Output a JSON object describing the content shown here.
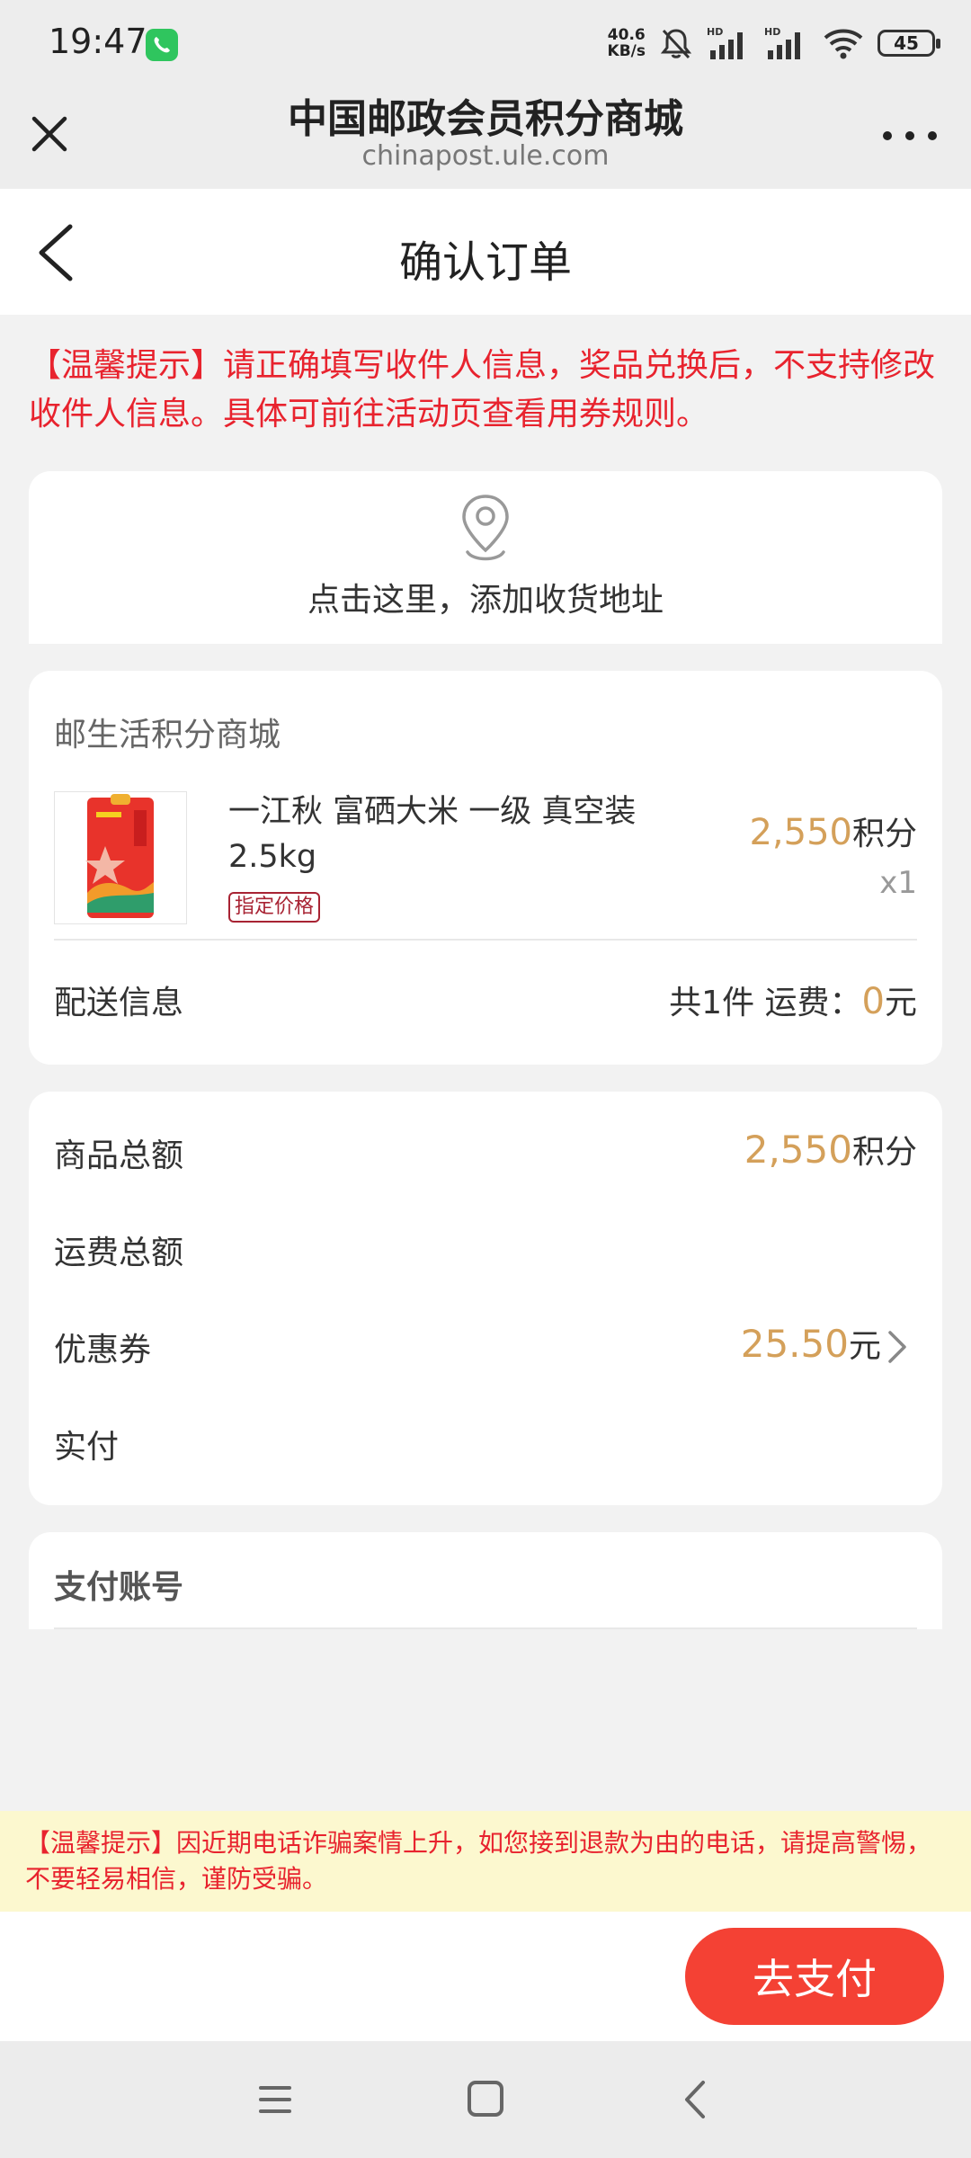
{
  "status_bar": {
    "time": "19:47",
    "net_speed_value": "40.6",
    "net_speed_unit": "KB/s",
    "battery": "45"
  },
  "browser": {
    "title": "中国邮政会员积分商城",
    "url": "chinapost.ule.com"
  },
  "page": {
    "title": "确认订单"
  },
  "notice": "【温馨提示】请正确填写收件人信息，奖品兑换后，不支持修改收件人信息。具体可前往活动页查看用券规则。",
  "address": {
    "prompt": "点击这里，添加收货地址"
  },
  "order": {
    "store_name": "邮生活积分商城",
    "product": {
      "name": "一江秋 富硒大米 一级 真空装 2.5kg",
      "tag": "指定价格",
      "price": "2,550",
      "price_unit": "积分",
      "quantity": "x1"
    },
    "delivery": {
      "label": "配送信息",
      "count_text": "共1件 运费：",
      "fee": "0",
      "fee_unit": "元"
    }
  },
  "summary": {
    "goods_total_label": "商品总额",
    "goods_total_value": "2,550",
    "goods_total_unit": "积分",
    "shipping_total_label": "运费总额",
    "coupon_label": "优惠券",
    "coupon_value": "25.50",
    "coupon_unit": "元",
    "actual_label": "实付"
  },
  "payment": {
    "account_label": "支付账号"
  },
  "warning": "【温馨提示】因近期电话诈骗案情上升，如您接到退款为由的电话，请提高警惕，不要轻易相信，谨防受骗。",
  "pay_button": "去支付",
  "colors": {
    "accent_red": "#f44134",
    "notice_red": "#e8232e",
    "gold": "#d4a05a",
    "warning_bg": "#fcf8cf"
  },
  "icons": [
    "call-icon",
    "mute-icon",
    "signal-icon",
    "wifi-icon",
    "battery-icon",
    "close-icon",
    "more-icon",
    "back-arrow-icon",
    "location-pin-icon",
    "chevron-right-icon",
    "menu-icon",
    "home-icon",
    "back-nav-icon"
  ]
}
